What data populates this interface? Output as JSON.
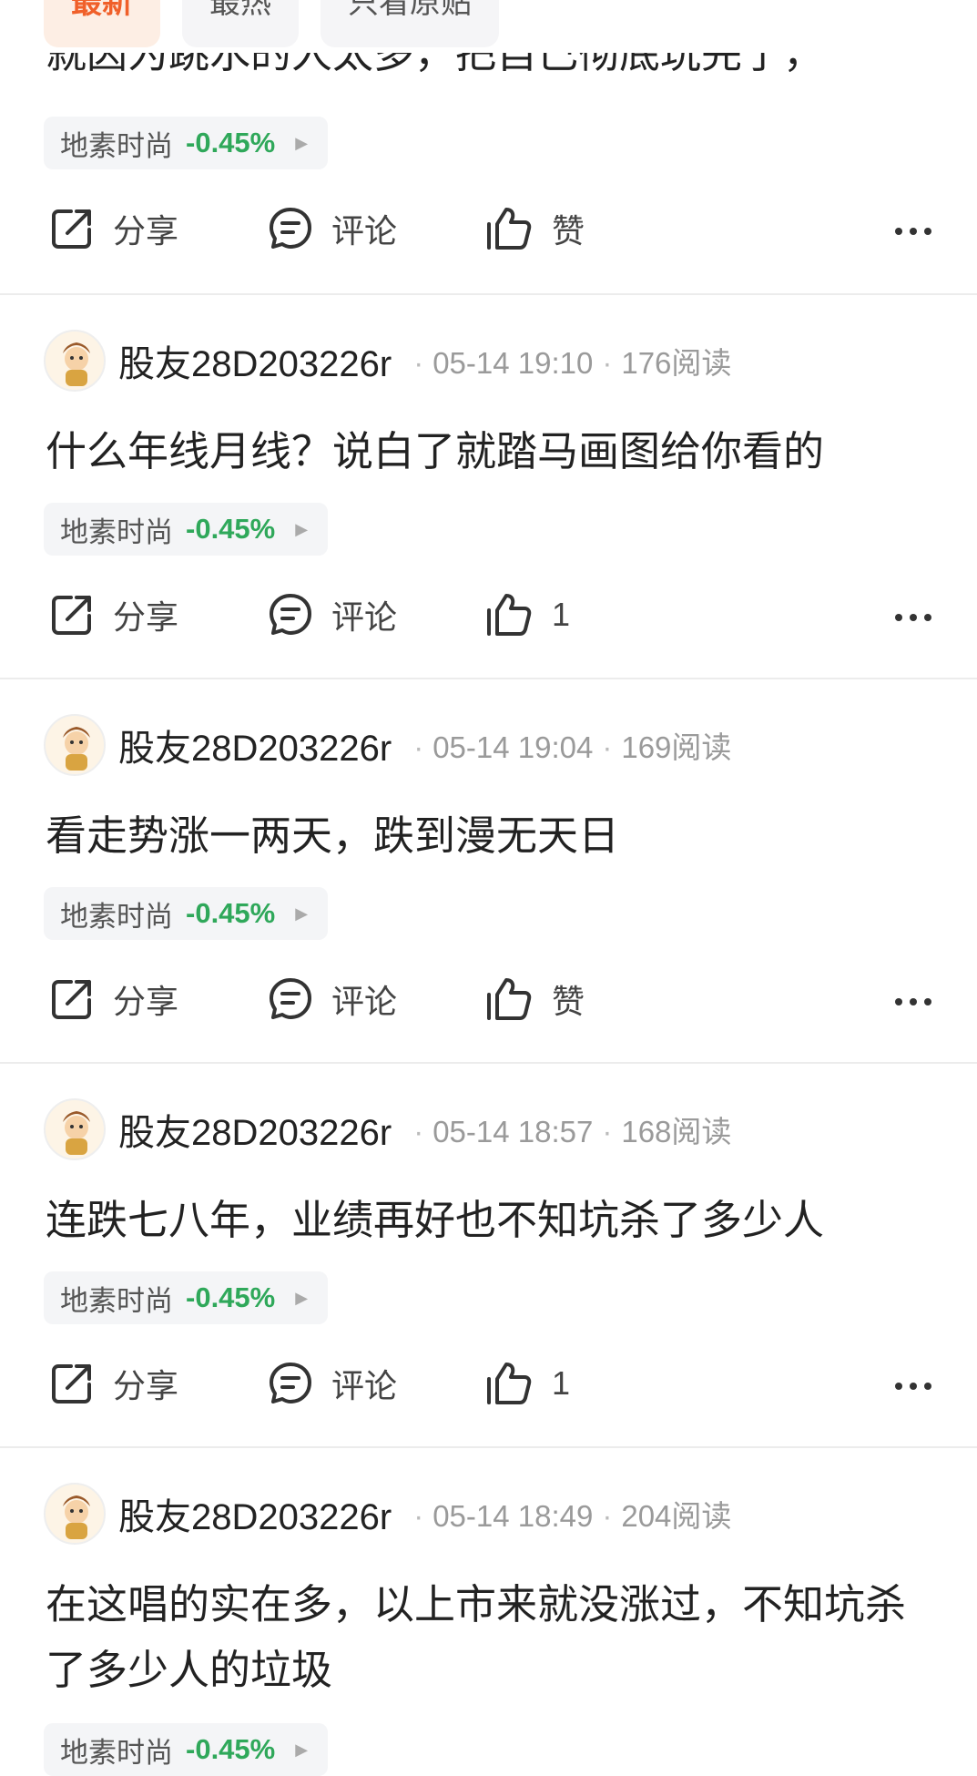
{
  "tabs": [
    {
      "label": "最新",
      "active": true
    },
    {
      "label": "最热",
      "active": false
    },
    {
      "label": "只看原贴",
      "active": false
    }
  ],
  "first_post": {
    "content_cut": "就因为跳水的人太多，把自己彻底玩完了，",
    "stock": {
      "name": "地素时尚",
      "change": "-0.45%"
    },
    "actions": {
      "share": "分享",
      "comment": "评论",
      "like": "赞"
    }
  },
  "posts": [
    {
      "author": "股友28D203226r",
      "time": "05-14 19:10",
      "reads": "176阅读",
      "content": "什么年线月线？说白了就踏马画图给你看的",
      "stock": {
        "name": "地素时尚",
        "change": "-0.45%"
      },
      "actions": {
        "share": "分享",
        "comment": "评论",
        "like": "1"
      }
    },
    {
      "author": "股友28D203226r",
      "time": "05-14 19:04",
      "reads": "169阅读",
      "content": "看走势涨一两天，跌到漫无天日",
      "stock": {
        "name": "地素时尚",
        "change": "-0.45%"
      },
      "actions": {
        "share": "分享",
        "comment": "评论",
        "like": "赞"
      }
    },
    {
      "author": "股友28D203226r",
      "time": "05-14 18:57",
      "reads": "168阅读",
      "content": "连跌七八年，业绩再好也不知坑杀了多少人",
      "stock": {
        "name": "地素时尚",
        "change": "-0.45%"
      },
      "actions": {
        "share": "分享",
        "comment": "评论",
        "like": "1"
      }
    },
    {
      "author": "股友28D203226r",
      "time": "05-14 18:49",
      "reads": "204阅读",
      "content": "在这唱的实在多，以上市来就没涨过，不知坑杀了多少人的垃圾",
      "stock": {
        "name": "地素时尚",
        "change": "-0.45%"
      }
    }
  ],
  "colors": {
    "accent": "#f0602a",
    "stock_change": "#2fa85a",
    "divider": "#ececec"
  }
}
